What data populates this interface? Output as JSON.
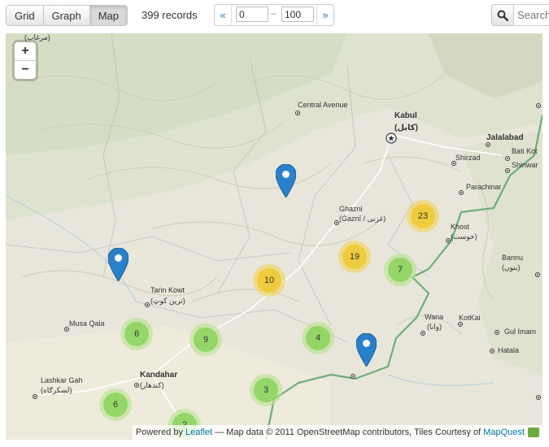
{
  "toolbar": {
    "views": [
      "Grid",
      "Graph",
      "Map"
    ],
    "active_view": "Map",
    "records": "399 records",
    "pager": {
      "prev": "«",
      "next": "»",
      "from": "0",
      "to": "100",
      "dash": "–"
    },
    "search_placeholder": "Search"
  },
  "map": {
    "zoom_in": "+",
    "zoom_out": "−",
    "places": [
      {
        "name": "Central Avenue"
      },
      {
        "name": "Kabul"
      },
      {
        "name": "(کابل)"
      },
      {
        "name": "Jalalabad"
      },
      {
        "name": "Shirzad"
      },
      {
        "name": "Bati Kot"
      },
      {
        "name": "Shinwar"
      },
      {
        "name": "Parachinar"
      },
      {
        "name": "Ghazni"
      },
      {
        "name": "(Ġaznī / غزنی)"
      },
      {
        "name": "Khost"
      },
      {
        "name": "(خوست)"
      },
      {
        "name": "Bannu"
      },
      {
        "name": "(بنوں)"
      },
      {
        "name": "Tarin Kowt"
      },
      {
        "name": "(ترین کوټ)"
      },
      {
        "name": "Musa Qala"
      },
      {
        "name": "Wana"
      },
      {
        "name": "(وانا)"
      },
      {
        "name": "KotKai"
      },
      {
        "name": "Gul Imam"
      },
      {
        "name": "Hatala"
      },
      {
        "name": "Kandahar"
      },
      {
        "name": "(کندهار)"
      },
      {
        "name": "Lashkar Gah"
      },
      {
        "name": "(لښکرګاه)"
      },
      {
        "name": "(مرغاب)"
      }
    ],
    "clusters": [
      {
        "count": "23",
        "color": "yellow"
      },
      {
        "count": "19",
        "color": "yellow"
      },
      {
        "count": "10",
        "color": "yellow"
      },
      {
        "count": "7",
        "color": "green"
      },
      {
        "count": "6",
        "color": "green"
      },
      {
        "count": "9",
        "color": "green"
      },
      {
        "count": "4",
        "color": "green"
      },
      {
        "count": "3",
        "color": "green"
      },
      {
        "count": "6",
        "color": "green"
      },
      {
        "count": "2",
        "color": "green"
      }
    ],
    "markers": 3,
    "attribution": {
      "prefix": "Powered by",
      "leaflet": "Leaflet",
      "middle": "— Map data © 2011 OpenStreetMap contributors, Tiles Courtesy of",
      "mapquest": "MapQuest"
    }
  }
}
